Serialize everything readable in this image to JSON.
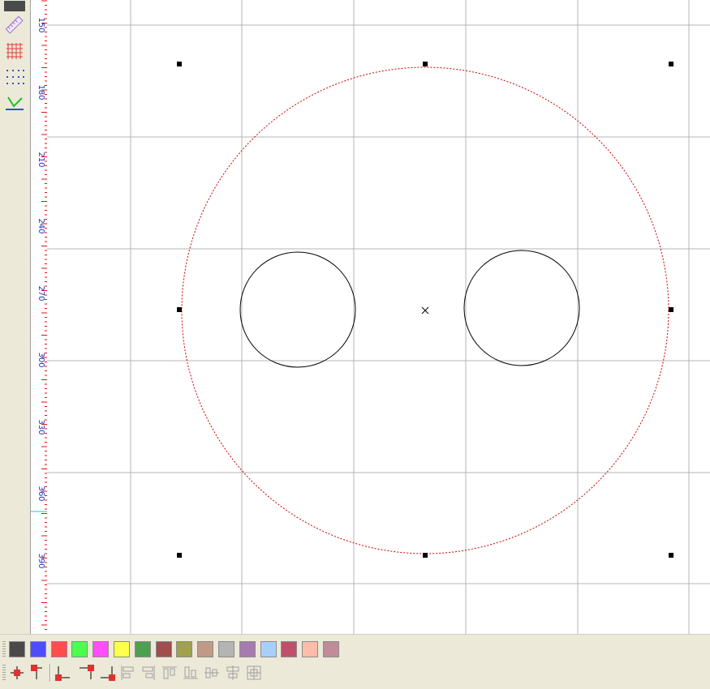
{
  "toolbar": {
    "tools": [
      {
        "name": "fill-color-icon"
      },
      {
        "name": "ruler-icon"
      },
      {
        "name": "grid-icon"
      },
      {
        "name": "dot-grid-icon"
      },
      {
        "name": "snap-icon"
      }
    ]
  },
  "ruler": {
    "labels": [
      "150",
      "180",
      "210",
      "240",
      "270",
      "300",
      "330",
      "360",
      "390"
    ]
  },
  "canvas": {
    "outer_circle_color": "#cc0000",
    "inner_circle_color": "#000000",
    "grid_color": "#b4b4b4"
  },
  "palette": {
    "colors": [
      "#4a4a4a",
      "#4d4dff",
      "#ff4d4d",
      "#4dff4d",
      "#ff4dff",
      "#ffff4d",
      "#4da04d",
      "#a04d4d",
      "#a0a04d",
      "#c09a88",
      "#b4b4b4",
      "#a87bb0",
      "#a8d0ff",
      "#c0506a",
      "#ffbca8",
      "#c08c98"
    ]
  },
  "align_tools": [
    {
      "name": "snap-center-icon"
    },
    {
      "name": "snap-top-icon"
    },
    {
      "name": "snap-bottom-left-icon"
    },
    {
      "name": "snap-top-right-icon"
    },
    {
      "name": "snap-bottom-right-icon"
    },
    {
      "name": "align-left-icon"
    },
    {
      "name": "align-right-icon"
    },
    {
      "name": "align-top-icon"
    },
    {
      "name": "align-bottom-icon"
    },
    {
      "name": "align-center-horizontal-icon"
    },
    {
      "name": "align-center-vertical-icon"
    },
    {
      "name": "align-grid-icon"
    }
  ]
}
